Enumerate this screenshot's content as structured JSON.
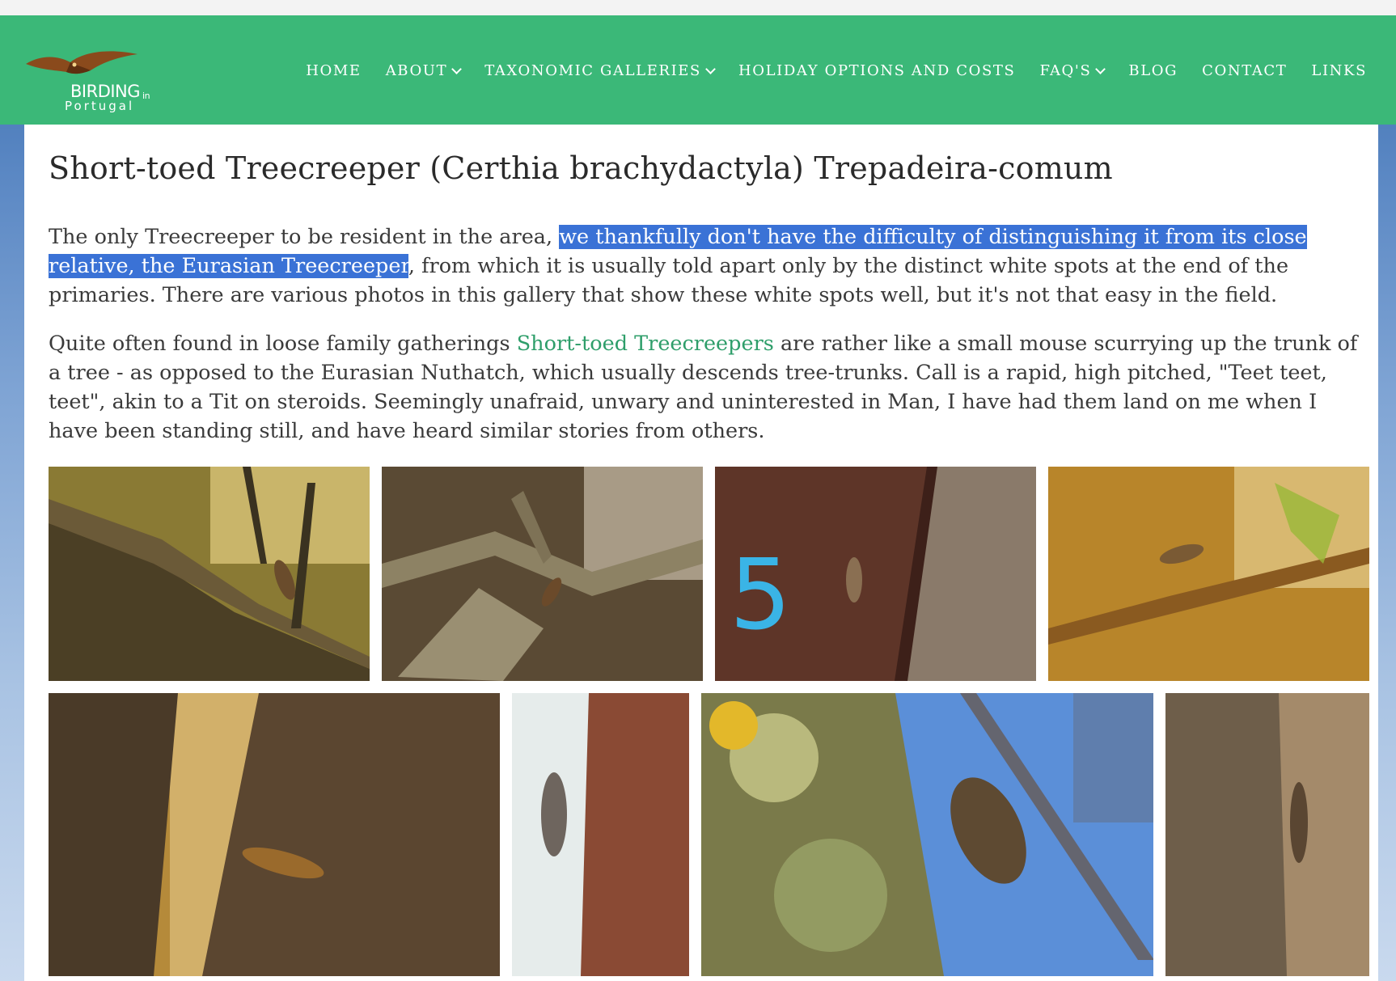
{
  "nav": {
    "logo_main": "BIRDING",
    "logo_in": "in",
    "logo_sub": "Portugal",
    "items": [
      {
        "label": "HOME",
        "dropdown": false
      },
      {
        "label": "ABOUT",
        "dropdown": true
      },
      {
        "label": "TAXONOMIC GALLERIES",
        "dropdown": true
      },
      {
        "label": "HOLIDAY OPTIONS AND COSTS",
        "dropdown": false
      },
      {
        "label": "FAQ'S",
        "dropdown": true
      },
      {
        "label": "BLOG",
        "dropdown": false
      },
      {
        "label": "CONTACT",
        "dropdown": false
      },
      {
        "label": "LINKS",
        "dropdown": false
      }
    ]
  },
  "page": {
    "title": "Short-toed Treecreeper (Certhia brachydactyla) Trepadeira-comum",
    "p1_a": " The only Treecreeper to be resident in the area, ",
    "p1_highlight": "we thankfully don't have the difficulty of distinguishing it from its close relative, the Eurasian Treecreeper",
    "p1_b": ", from which it is usually told apart only by the distinct white spots at the end of the primaries. There are various photos in this gallery that show these white spots well, but it's not that easy in the field.",
    "p2_a": "Quite often found in loose family gatherings ",
    "p2_link": "Short-toed Treecreepers",
    "p2_b": " are rather like a small mouse scurrying up the trunk of a tree - as opposed to the Eurasian Nuthatch, which usually descends tree-trunks. Call is a rapid, high pitched, \"Teet teet, teet\", akin to a Tit on steroids. Seemingly unafraid, unwary and uninterested in Man, I have had them land on me when I have been standing still, and have heard similar stories from others."
  },
  "gallery": {
    "photo_3_marking": "5"
  },
  "colors": {
    "nav_bg": "#3bb878",
    "highlight": "#3a72d6",
    "link": "#2e9e6a"
  }
}
